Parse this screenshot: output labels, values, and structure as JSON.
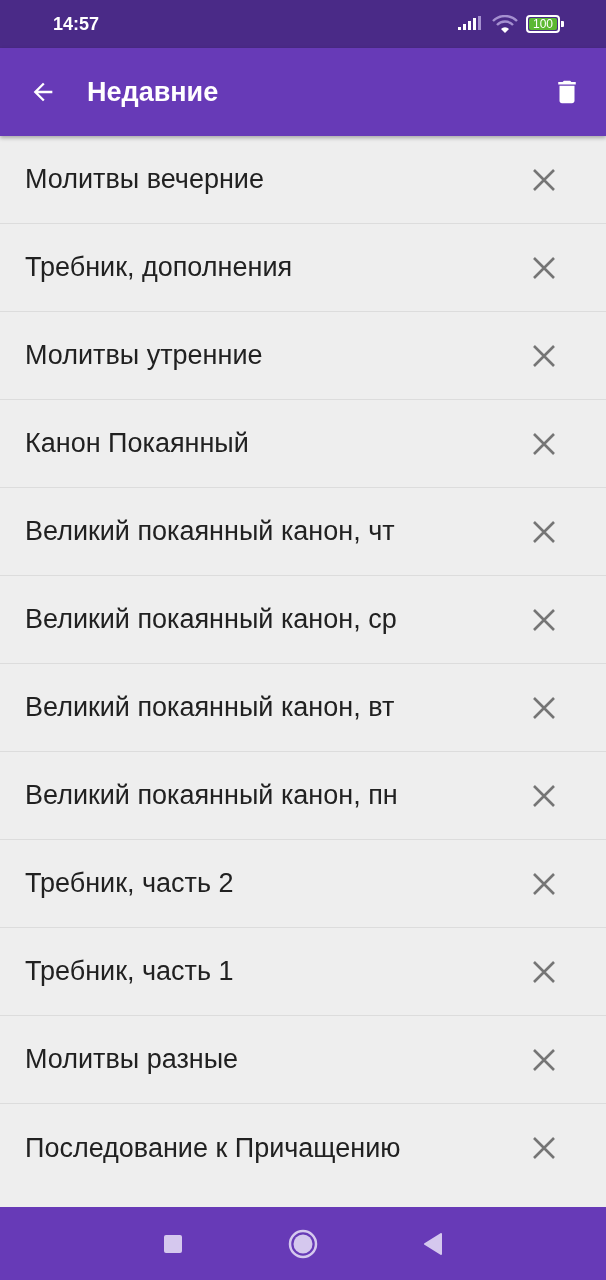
{
  "status_bar": {
    "time": "14:57",
    "battery": "100"
  },
  "app_bar": {
    "title": "Недавние"
  },
  "items": [
    {
      "title": "Молитвы вечерние"
    },
    {
      "title": "Требник, дополнения"
    },
    {
      "title": "Молитвы утренние"
    },
    {
      "title": "Канон Покаянный"
    },
    {
      "title": "Великий покаянный канон, чт"
    },
    {
      "title": "Великий покаянный канон, ср"
    },
    {
      "title": "Великий покаянный канон, вт"
    },
    {
      "title": "Великий покаянный канон, пн"
    },
    {
      "title": "Требник, часть 2"
    },
    {
      "title": "Требник, часть 1"
    },
    {
      "title": "Молитвы разные"
    },
    {
      "title": "Последование к Причащению"
    }
  ]
}
